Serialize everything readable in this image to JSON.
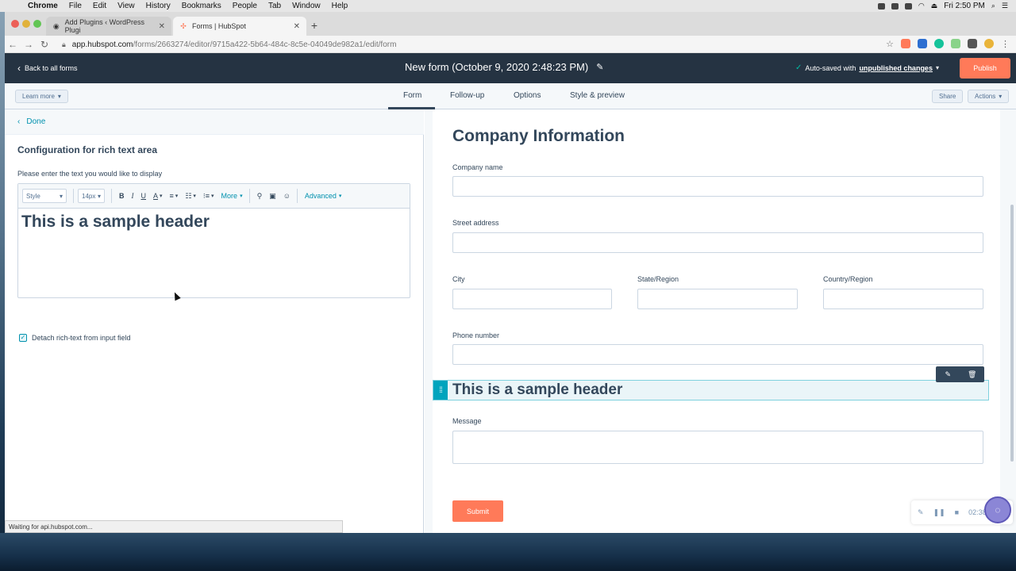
{
  "os_menubar": {
    "items": [
      "Chrome",
      "File",
      "Edit",
      "View",
      "History",
      "Bookmarks",
      "People",
      "Tab",
      "Window",
      "Help"
    ],
    "clock": "Fri 2:50 PM"
  },
  "browser": {
    "tabs": [
      {
        "title": "Add Plugins ‹ WordPress Plugi",
        "icon": "wordpress-icon"
      },
      {
        "title": "Forms | HubSpot",
        "icon": "hubspot-icon"
      }
    ],
    "url_host": "app.hubspot.com",
    "url_path": "/forms/2663274/editor/9715a422-5b64-484c-8c5e-04049de982a1/edit/form",
    "status": "Waiting for api.hubspot.com..."
  },
  "header": {
    "back": "Back to all forms",
    "title": "New form (October 9, 2020 2:48:23 PM)",
    "autosave_prefix": "Auto-saved with",
    "autosave_link": "unpublished changes",
    "publish": "Publish"
  },
  "subnav": {
    "learn_more": "Learn more",
    "tabs": [
      "Form",
      "Follow-up",
      "Options",
      "Style & preview"
    ],
    "active_tab": "Form",
    "share": "Share",
    "actions": "Actions"
  },
  "left": {
    "done": "Done",
    "title": "Configuration for rich text area",
    "instruction": "Please enter the text you would like to display",
    "toolbar": {
      "style": "Style",
      "size": "14px",
      "bold": "B",
      "italic": "I",
      "underline": "U",
      "color": "A",
      "more": "More",
      "advanced": "Advanced"
    },
    "editor_text": "This is a sample header",
    "detach_label": "Detach rich-text from input field",
    "detach_checked": true
  },
  "preview": {
    "section_title": "Company Information",
    "fields": {
      "company": "Company name",
      "street": "Street address",
      "city": "City",
      "state": "State/Region",
      "country": "Country/Region",
      "phone": "Phone number",
      "message": "Message"
    },
    "rich_text": "This is a sample header",
    "submit": "Submit",
    "recorder_time": "02:38"
  },
  "colors": {
    "hubspot_dark": "#253342",
    "accent_orange": "#ff7a59",
    "link_teal": "#0091ae",
    "text": "#33475b"
  }
}
